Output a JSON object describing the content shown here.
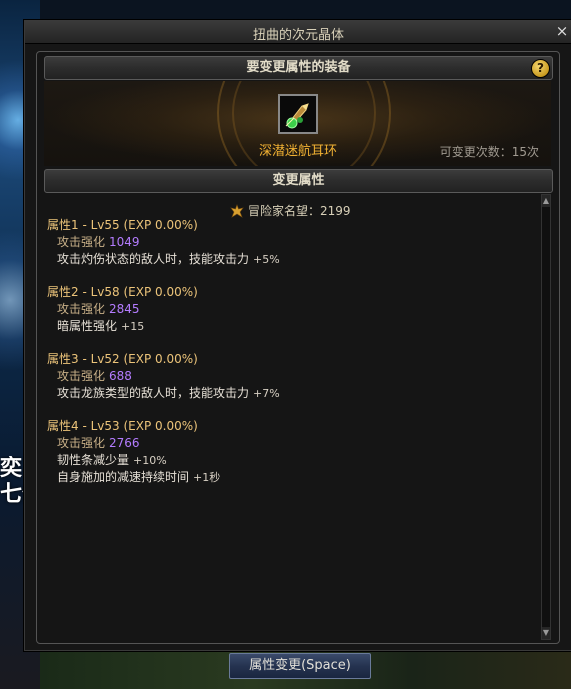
{
  "window": {
    "title": "扭曲的次元晶体",
    "close_label": "×"
  },
  "equip_section": {
    "header": "要变更属性的装备",
    "help_label": "?"
  },
  "item": {
    "name": "深潜迷航耳环",
    "change_count": "可变更次数：15次"
  },
  "attr_section": {
    "header": "变更属性"
  },
  "reputation": {
    "label": "冒险家名望：2199"
  },
  "attributes": [
    {
      "title": "属性1 - Lv55 (EXP 0.00%)",
      "base_label": "攻击强化",
      "base_value": "1049",
      "effect": "攻击灼伤状态的敌人时，技能攻击力",
      "bonus": "+5%"
    },
    {
      "title": "属性2 - Lv58 (EXP 0.00%)",
      "base_label": "攻击强化",
      "base_value": "2845",
      "effect": "暗属性强化",
      "bonus": "+15"
    },
    {
      "title": "属性3 - Lv52 (EXP 0.00%)",
      "base_label": "攻击强化",
      "base_value": "688",
      "effect": "攻击龙族类型的敌人时，技能攻击力",
      "bonus": "+7%"
    },
    {
      "title": "属性4 - Lv53 (EXP 0.00%)",
      "base_label": "攻击强化",
      "base_value": "2766",
      "effect": "韧性条减少量",
      "bonus": "+10%",
      "effect2": "自身施加的减速持续时间",
      "bonus2": "+1秒"
    }
  ],
  "action_button": {
    "label": "属性变更(Space)"
  },
  "background": {
    "side_text": "奕 好\n七什"
  },
  "colors": {
    "item_name": "#f2b233",
    "attr_title": "#ecc47a",
    "value_purple": "#b47cff"
  }
}
